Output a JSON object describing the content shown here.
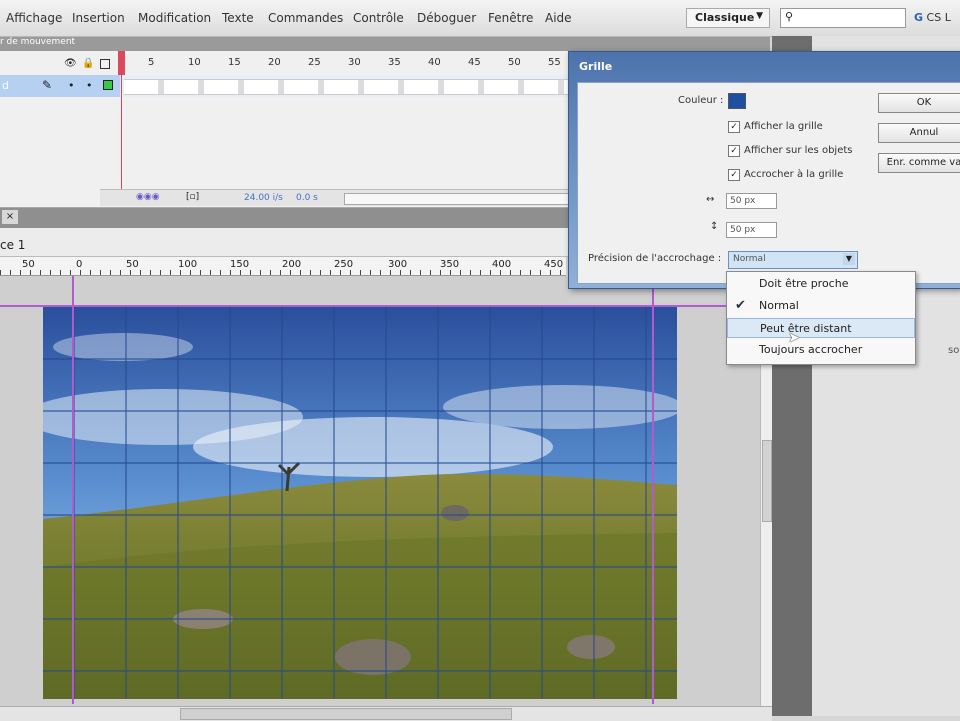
{
  "menu": {
    "items": [
      "Affichage",
      "Insertion",
      "Modification",
      "Texte",
      "Commandes",
      "Contrôle",
      "Déboguer",
      "Fenêtre",
      "Aide"
    ],
    "workspace": "Classique",
    "cs_label": "CS L"
  },
  "timeline": {
    "panel_tab": "r de mouvement",
    "layer_name": "d",
    "frame_numbers": [
      "5",
      "10",
      "15",
      "20",
      "25",
      "30",
      "35",
      "40",
      "45",
      "50",
      "55"
    ],
    "fps": "24.00 i/s",
    "time": "0.0 s"
  },
  "stage": {
    "scene_label": "ce 1",
    "ruler_numbers": [
      "50",
      "0",
      "50",
      "100",
      "150",
      "200",
      "250",
      "300",
      "350",
      "400",
      "450"
    ],
    "photo_description": "landscape-photo"
  },
  "dialog": {
    "title": "Grille",
    "color_label": "Couleur :",
    "color": "#1f4fa3",
    "show_grid": "Afficher la grille",
    "show_over_objects": "Afficher sur les objets",
    "snap_to_grid": "Accrocher à la grille",
    "width_value": "50 px",
    "height_value": "50 px",
    "snap_accuracy_label": "Précision de l'accrochage :",
    "snap_accuracy_value": "Normal",
    "ok_button": "OK",
    "cancel_button": "Annul",
    "save_default_button": "Enr. comme va"
  },
  "dropdown": {
    "items": [
      "Doit être proche",
      "Normal",
      "Peut être distant",
      "Toujours accrocher"
    ],
    "selected_index": 1,
    "hover_index": 2
  },
  "right_panel": {
    "text": "son séle"
  },
  "colors": {
    "accent": "#4d73ad",
    "guide": "#b05bd0",
    "playhead": "#d94b5b"
  }
}
